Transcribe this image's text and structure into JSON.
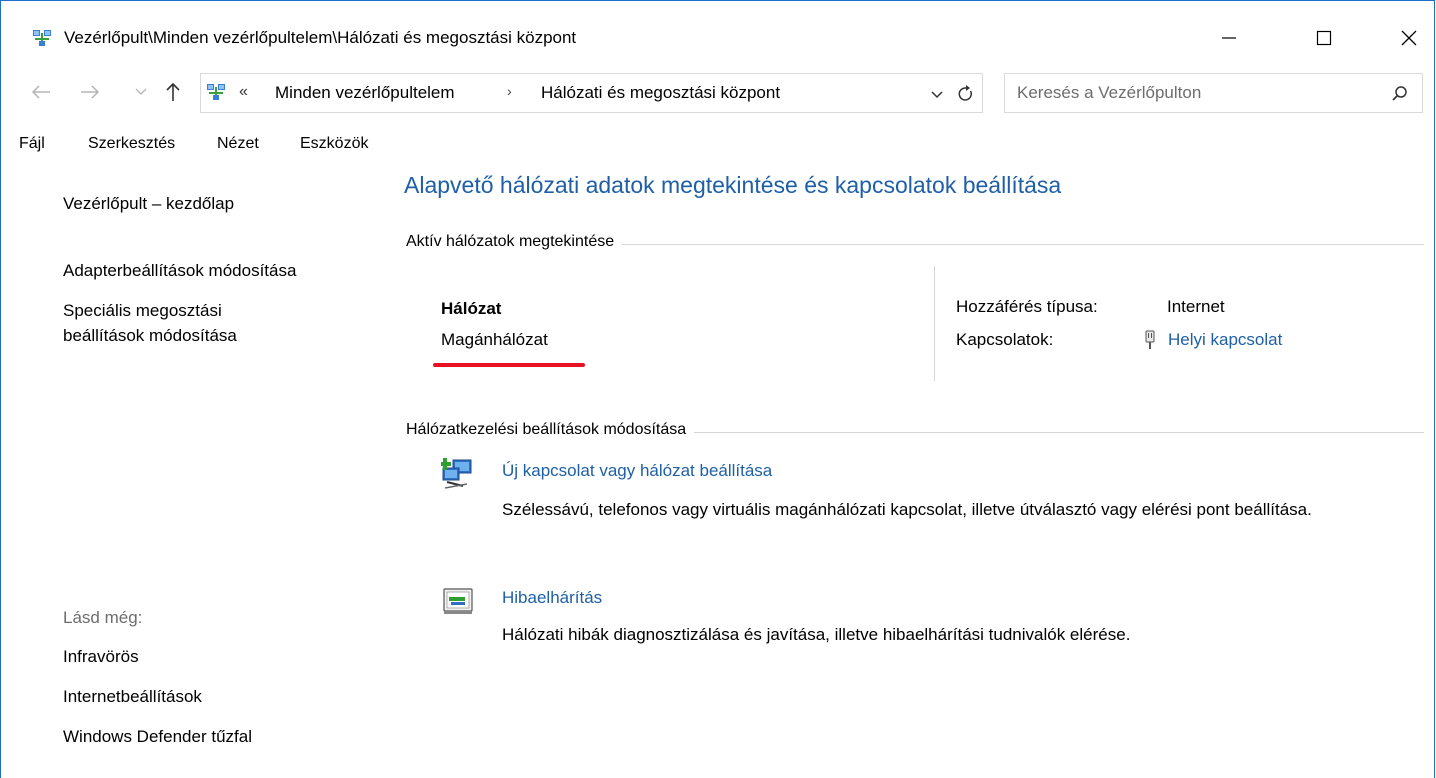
{
  "window": {
    "title": "Vezérlőpult\\Minden vezérlőpultelem\\Hálózati és megosztási központ"
  },
  "address_bar": {
    "overflow": "«",
    "breadcrumbs": [
      "Minden vezérlőpultelem",
      "Hálózati és megosztási központ"
    ],
    "separator": "›"
  },
  "search": {
    "placeholder": "Keresés a Vezérlőpulton"
  },
  "menu": {
    "items": [
      "Fájl",
      "Szerkesztés",
      "Nézet",
      "Eszközök"
    ]
  },
  "sidebar": {
    "home": "Vezérlőpult – kezdőlap",
    "adapter": "Adapterbeállítások módosítása",
    "sharing_line1": "Speciális megosztási",
    "sharing_line2": "beállítások módosítása",
    "see_also_label": "Lásd még:",
    "see_also": [
      "Infravörös",
      "Internetbeállítások",
      "Windows Defender tűzfal"
    ]
  },
  "main": {
    "heading": "Alapvető hálózati adatok megtekintése és kapcsolatok beállítása",
    "active_section": "Aktív hálózatok megtekintése",
    "network_label": "Hálózat",
    "network_name": "Magánhálózat",
    "access_type_label": "Hozzáférés típusa:",
    "access_type_value": "Internet",
    "connections_label": "Kapcsolatok:",
    "connection_link": "Helyi kapcsolat",
    "settings_section": "Hálózatkezelési beállítások módosítása",
    "tasks": [
      {
        "title": "Új kapcsolat vagy hálózat beállítása",
        "description": "Szélessávú, telefonos vagy virtuális magánhálózati kapcsolat, illetve útválasztó vagy elérési pont beállítása."
      },
      {
        "title": "Hibaelhárítás",
        "description": "Hálózati hibák diagnosztizálása és javítása, illetve hibaelhárítási tudnivalók elérése."
      }
    ]
  },
  "colors": {
    "link": "#1e5fa8",
    "window_border": "#1e6fc7",
    "highlight_underline": "#e81123"
  },
  "icons": {
    "app": "network-center-icon",
    "back": "arrow-left-icon",
    "forward": "arrow-right-icon",
    "recent": "chevron-down-icon",
    "up": "arrow-up-icon",
    "refresh": "refresh-icon",
    "search": "search-icon",
    "connection": "ethernet-plug-icon",
    "new_connection": "new-connection-icon",
    "troubleshoot": "troubleshoot-icon"
  }
}
